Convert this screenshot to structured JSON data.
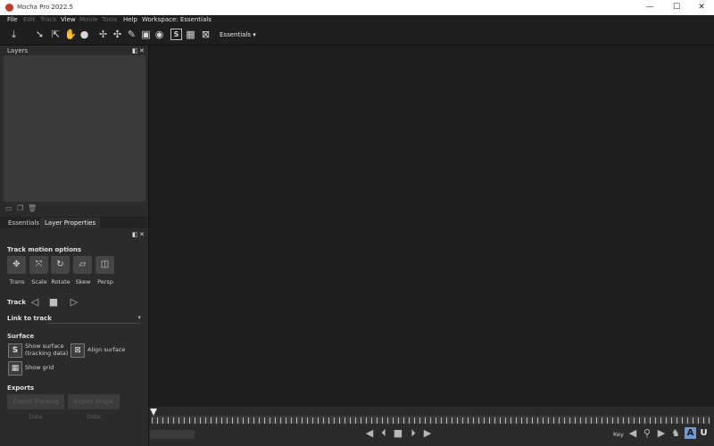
{
  "window": {
    "title": "Mocha Pro 2022.5",
    "minimize": "—",
    "maximize": "☐",
    "close": "✕"
  },
  "menu": [
    {
      "label": "File",
      "enabled": true
    },
    {
      "label": "Edit",
      "enabled": false
    },
    {
      "label": "Track",
      "enabled": false
    },
    {
      "label": "View",
      "enabled": true
    },
    {
      "label": "Movie",
      "enabled": false
    },
    {
      "label": "Tools",
      "enabled": false
    },
    {
      "label": "Help",
      "enabled": true
    },
    {
      "label": "Workspace: Essentials",
      "enabled": true
    }
  ],
  "toolbar": {
    "workspace_value": "Essentials",
    "workspace_arrow": "▾",
    "surface_glyph": "S"
  },
  "layers_panel": {
    "title": "Layers",
    "float": "◧",
    "close": "✕"
  },
  "tabs": [
    {
      "label": "Essentials",
      "active": false
    },
    {
      "label": "Layer Properties",
      "active": true
    }
  ],
  "properties_panel": {
    "float": "◧",
    "close": "✕",
    "track_motion_title": "Track motion options",
    "motion_options": [
      "Trans",
      "Scale",
      "Rotate",
      "Skew",
      "Persp"
    ],
    "track_label": "Track",
    "link_to_track_label": "Link to track",
    "link_to_track_value": "",
    "link_arrow": "▾",
    "surface_title": "Surface",
    "show_surface_line1": "Show surface",
    "show_surface_line2": "(tracking data)",
    "align_surface": "Align surface",
    "show_grid": "Show grid",
    "exports_title": "Exports",
    "export_buttons": [
      "Export Tracking Data",
      "Export Shape Data"
    ]
  },
  "timeline": {
    "key_label": "Key",
    "auto_key": "A",
    "overwrite_key": "U"
  }
}
